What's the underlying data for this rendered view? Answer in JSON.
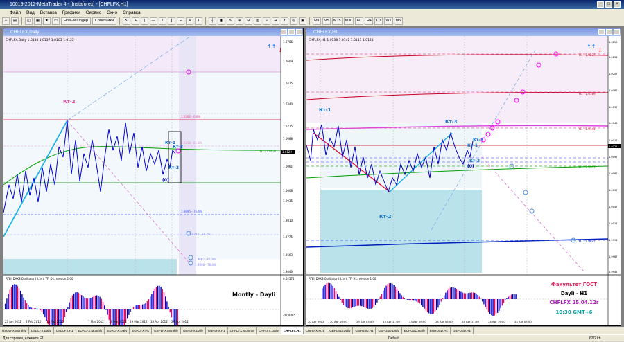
{
  "app": {
    "title": "10019-2012-MetaTrader 4 - [Instaforex] - [CHFLFX,H1]"
  },
  "menu": [
    "Файл",
    "Вид",
    "Вставка",
    "Графики",
    "Сервис",
    "Окно",
    "Справка"
  ],
  "toolbar": {
    "new_order": "Новый Ордер",
    "advisors": "Советники",
    "timeframes": [
      "M1",
      "M5",
      "M15",
      "M30",
      "H1",
      "H4",
      "D1",
      "W1",
      "MN"
    ]
  },
  "left_chart": {
    "window_title": "CHFLFX,Daily",
    "info": "CHFLFX,Daily  1.0134 1.0137 1.0105 1.0122",
    "y_ticks": [
      "1.0706",
      "1.0609",
      "1.0475",
      "1.0340",
      "1.0215",
      "1.0088",
      "1.0061",
      "1.0008",
      "1.9935",
      "1.9810",
      "1.9775",
      "1.9663",
      "1.9446"
    ],
    "price_label": "1.0122",
    "x_ticks": [
      "23 Jan 2012",
      "2 Feb 2012",
      "14 Feb 2012",
      "7 Mar 2012",
      "19 Mar 2012",
      "29 Mar 2012",
      "18 Apr 2012",
      "29 Apr 2012"
    ],
    "labels": {
      "kr2": "Кт-2",
      "kr1": "Кт-1",
      "kr3": "Кт-3",
      "kr2b": "Кт-2",
      "zero": "(0)"
    },
    "level_texts": [
      "1.0362 - 0.0%",
      "1.0258 - 61.8%",
      "H1 - 1.0037",
      "1.9895 - 76.4%",
      "1.9782 - 38.2%",
      "1.9662 - 61.8%",
      "1.9596 - 76.4%"
    ],
    "indicator": {
      "label": "ATEI_DAKS Oscillator (5,34), TF: D1, version 1.00",
      "y_top": "0.02574",
      "y_bottom": "-0.00895"
    },
    "caption": "Montly - Dayli"
  },
  "right_chart": {
    "window_title": "CHFLFX,H1",
    "info": "CHFLFX,H1  1.0138 1.0142 1.0111 1.0121",
    "y_ticks": [
      "1.0256",
      "1.0232",
      "1.0207",
      "1.0182",
      "1.0157",
      "1.0142",
      "1.0112",
      "1.0097",
      "1.0082",
      "1.0057",
      "1.0047",
      "1.0017",
      "1.9992",
      "1.9967",
      "1.9942"
    ],
    "price_label": "1.0121",
    "x_ticks": [
      "20 Apr 2012",
      "20 Apr 19:00",
      "23 Apr 03:00",
      "23 Apr 11:00",
      "23 Apr 19:00",
      "24 Apr 03:00",
      "24 Apr 11:00",
      "24 Apr 19:00",
      "25 Apr 03:00"
    ],
    "labels": {
      "kr1": "Кт-1",
      "kr3": "Кт-3",
      "kr2": "Кт-2",
      "kr1b": "Кт-1",
      "kr3b": "Кт-3",
      "kr2b": "Кт-2",
      "zero": "(0)"
    },
    "level_texts": [
      "H1 - 1.0237",
      "H1 - 1.0189",
      "H1 - 1.0141",
      "H1 - 1.0093",
      "H1 - 1.9997"
    ],
    "indicator": {
      "label": "ATEI_DAKS Oscillator (5,34), TF: H1, version 1.00"
    },
    "caption": {
      "line1": "Факультет ГОСТ",
      "line2": "Dayli - H1",
      "line3": "CHFLFX 25.04.12г",
      "line4": "10:30 GMT+6"
    }
  },
  "tabs": [
    "USDLFX,Monthly",
    "USDLFX,Daily",
    "USDLFX,H1",
    "EURLFX,Monthly",
    "EURLFX,Daily",
    "EURLFX,H1",
    "GBPLFX,Monthly",
    "GBPLFX,Daily",
    "GBPLFX,H1",
    "CHFLFX,Monthly",
    "CHFLFX,Daily",
    "CHFLFX,H1",
    "CHFLFX,M15",
    "GBPUSD,Daily",
    "GBPUSD,H1",
    "GBPUSD,Daily",
    "EURUSD,Daily",
    "EURUSD,H1",
    "GBPUSD,H1"
  ],
  "active_tab": "CHFLFX,H1",
  "status": {
    "help": "Для справки, нажмите F1",
    "profile": "Default",
    "traffic": "62/2 kb"
  },
  "colors": {
    "accent": "#0a246a",
    "up": "#0000cc",
    "down": "#ff0066"
  }
}
